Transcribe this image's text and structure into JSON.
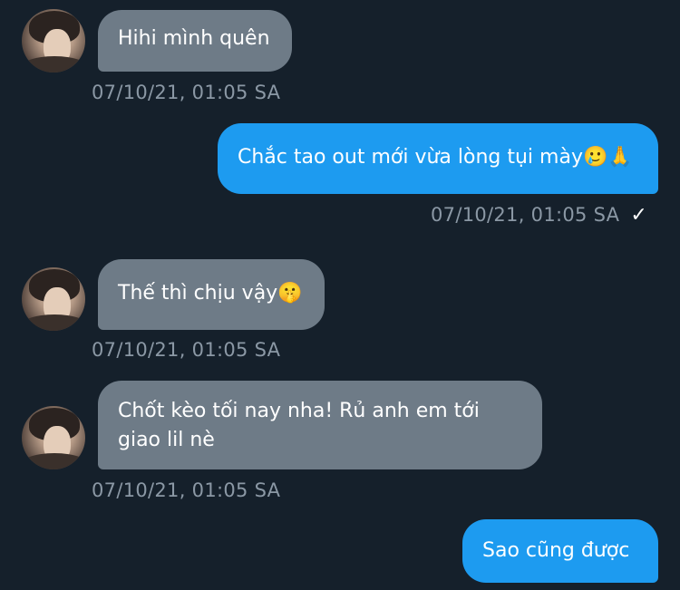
{
  "messages": [
    {
      "direction": "incoming",
      "text": "Hihi mình quên",
      "timestamp": "07/10/21, 01:05 SA"
    },
    {
      "direction": "outgoing",
      "text": "Chắc tao out mới vừa lòng tụi mày🥲🙏",
      "timestamp": "07/10/21, 01:05 SA",
      "status_icon": "✓"
    },
    {
      "direction": "incoming",
      "text": "Thế thì chịu vậy🤫",
      "timestamp": "07/10/21, 01:05 SA"
    },
    {
      "direction": "incoming",
      "text": "Chốt kèo tối nay nha! Rủ anh em tới giao lil nè",
      "timestamp": "07/10/21, 01:05 SA"
    },
    {
      "direction": "outgoing",
      "text": "Sao cũng được"
    }
  ],
  "colors": {
    "background": "#15202b",
    "incoming_bubble": "#6e7b87",
    "outgoing_bubble": "#1d9bf0",
    "timestamp": "#8b98a5"
  }
}
